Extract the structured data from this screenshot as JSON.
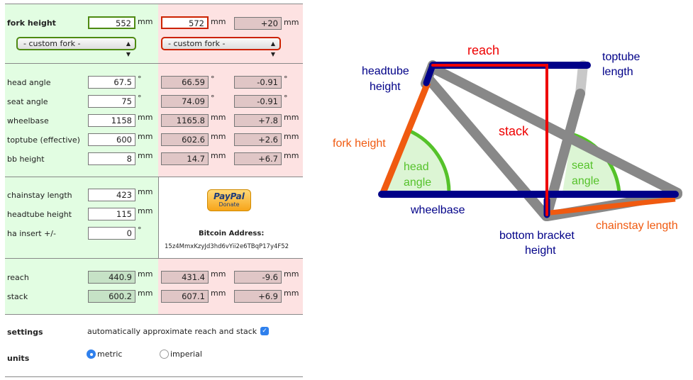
{
  "fork": {
    "label": "fork height",
    "value": "552",
    "value2": "572",
    "diff": "+20",
    "unit": "mm",
    "select1": "- custom fork -",
    "select2": "- custom fork -"
  },
  "angles": [
    {
      "label": "head angle",
      "value": "67.5",
      "value2": "66.59",
      "diff": "-0.91",
      "unit": "°"
    },
    {
      "label": "seat angle",
      "value": "75",
      "value2": "74.09",
      "diff": "-0.91",
      "unit": "°"
    },
    {
      "label": "wheelbase",
      "value": "1158",
      "value2": "1165.8",
      "diff": "+7.8",
      "unit": "mm"
    },
    {
      "label": "toptube (effective)",
      "value": "600",
      "value2": "602.6",
      "diff": "+2.6",
      "unit": "mm"
    },
    {
      "label": "bb height",
      "value": "8",
      "value2": "14.7",
      "diff": "+6.7",
      "unit": "mm"
    }
  ],
  "extras": [
    {
      "label": "chainstay length",
      "value": "423",
      "unit": "mm"
    },
    {
      "label": "headtube height",
      "value": "115",
      "unit": "mm"
    },
    {
      "label": "ha insert +/-",
      "value": "0",
      "unit": "°"
    }
  ],
  "donate": {
    "paypal": "PayPal",
    "donate": "Donate",
    "bitcoin_label": "Bitcoin Address:",
    "bitcoin_address": "15z4MmxKzyJd3hd6vYii2e6TBqP17y4F52"
  },
  "results": [
    {
      "label": "reach",
      "value": "440.9",
      "value2": "431.4",
      "diff": "-9.6",
      "unit": "mm"
    },
    {
      "label": "stack",
      "value": "600.2",
      "value2": "607.1",
      "diff": "+6.9",
      "unit": "mm"
    }
  ],
  "settings": {
    "label": "settings",
    "auto_label": "automatically approximate reach and stack",
    "auto_checked": true
  },
  "units": {
    "label": "units",
    "metric": "metric",
    "imperial": "imperial",
    "selected": "metric"
  },
  "diagram": {
    "reach": "reach",
    "toptube1": "toptube",
    "toptube2": "length",
    "headtube1": "headtube",
    "headtube2": "height",
    "stack": "stack",
    "fork": "fork height",
    "head1": "head",
    "head2": "angle",
    "seat1": "seat",
    "seat2": "angle",
    "wheelbase": "wheelbase",
    "bb1": "bottom bracket",
    "bb2": "height",
    "chainstay": "chainstay length"
  },
  "colors": {
    "green_border": "#4e8a12",
    "red_border": "#cc2200",
    "navy": "#000088",
    "red": "#ee0000",
    "orange": "#f05a10",
    "green": "#55c22a",
    "gray": "#888888"
  }
}
